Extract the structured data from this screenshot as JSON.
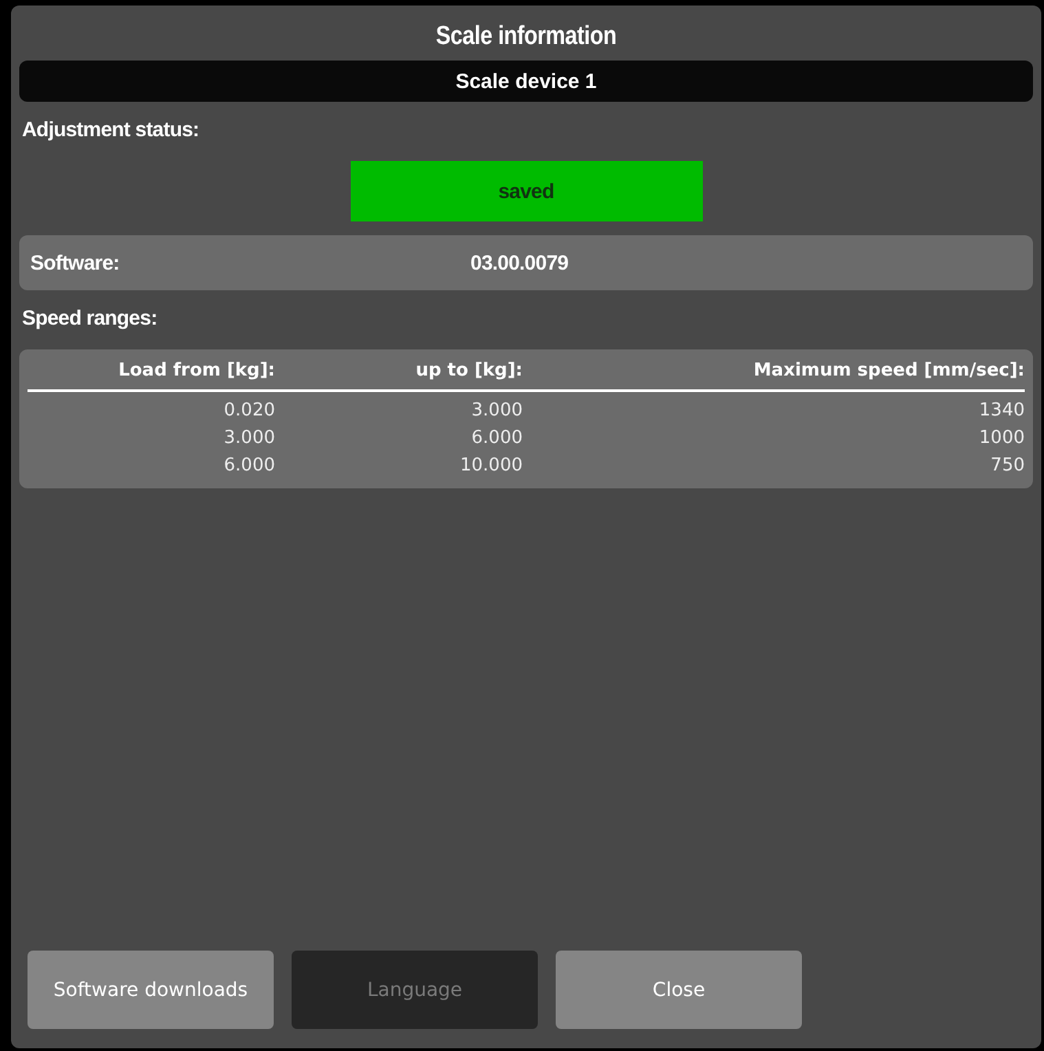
{
  "window": {
    "title": "Scale information"
  },
  "device": "Scale device 1",
  "adjustment": {
    "label": "Adjustment status:",
    "value": "saved",
    "kind": "ok"
  },
  "software": {
    "label": "Software:",
    "value": "03.00.0079"
  },
  "speed_ranges": {
    "label": "Speed ranges:",
    "table": {
      "columns": [
        "Load from [kg]:",
        "up to [kg]:",
        "Maximum speed [mm/sec]:"
      ],
      "rows": [
        [
          "0.020",
          "3.000",
          "1340"
        ],
        [
          "3.000",
          "6.000",
          "1000"
        ],
        [
          "6.000",
          "10.000",
          "750"
        ]
      ]
    }
  },
  "buttons": [
    {
      "label": "Software downloads",
      "disabled": false
    },
    {
      "label": "Language",
      "disabled": true
    },
    {
      "label": "Close",
      "disabled": false
    }
  ]
}
